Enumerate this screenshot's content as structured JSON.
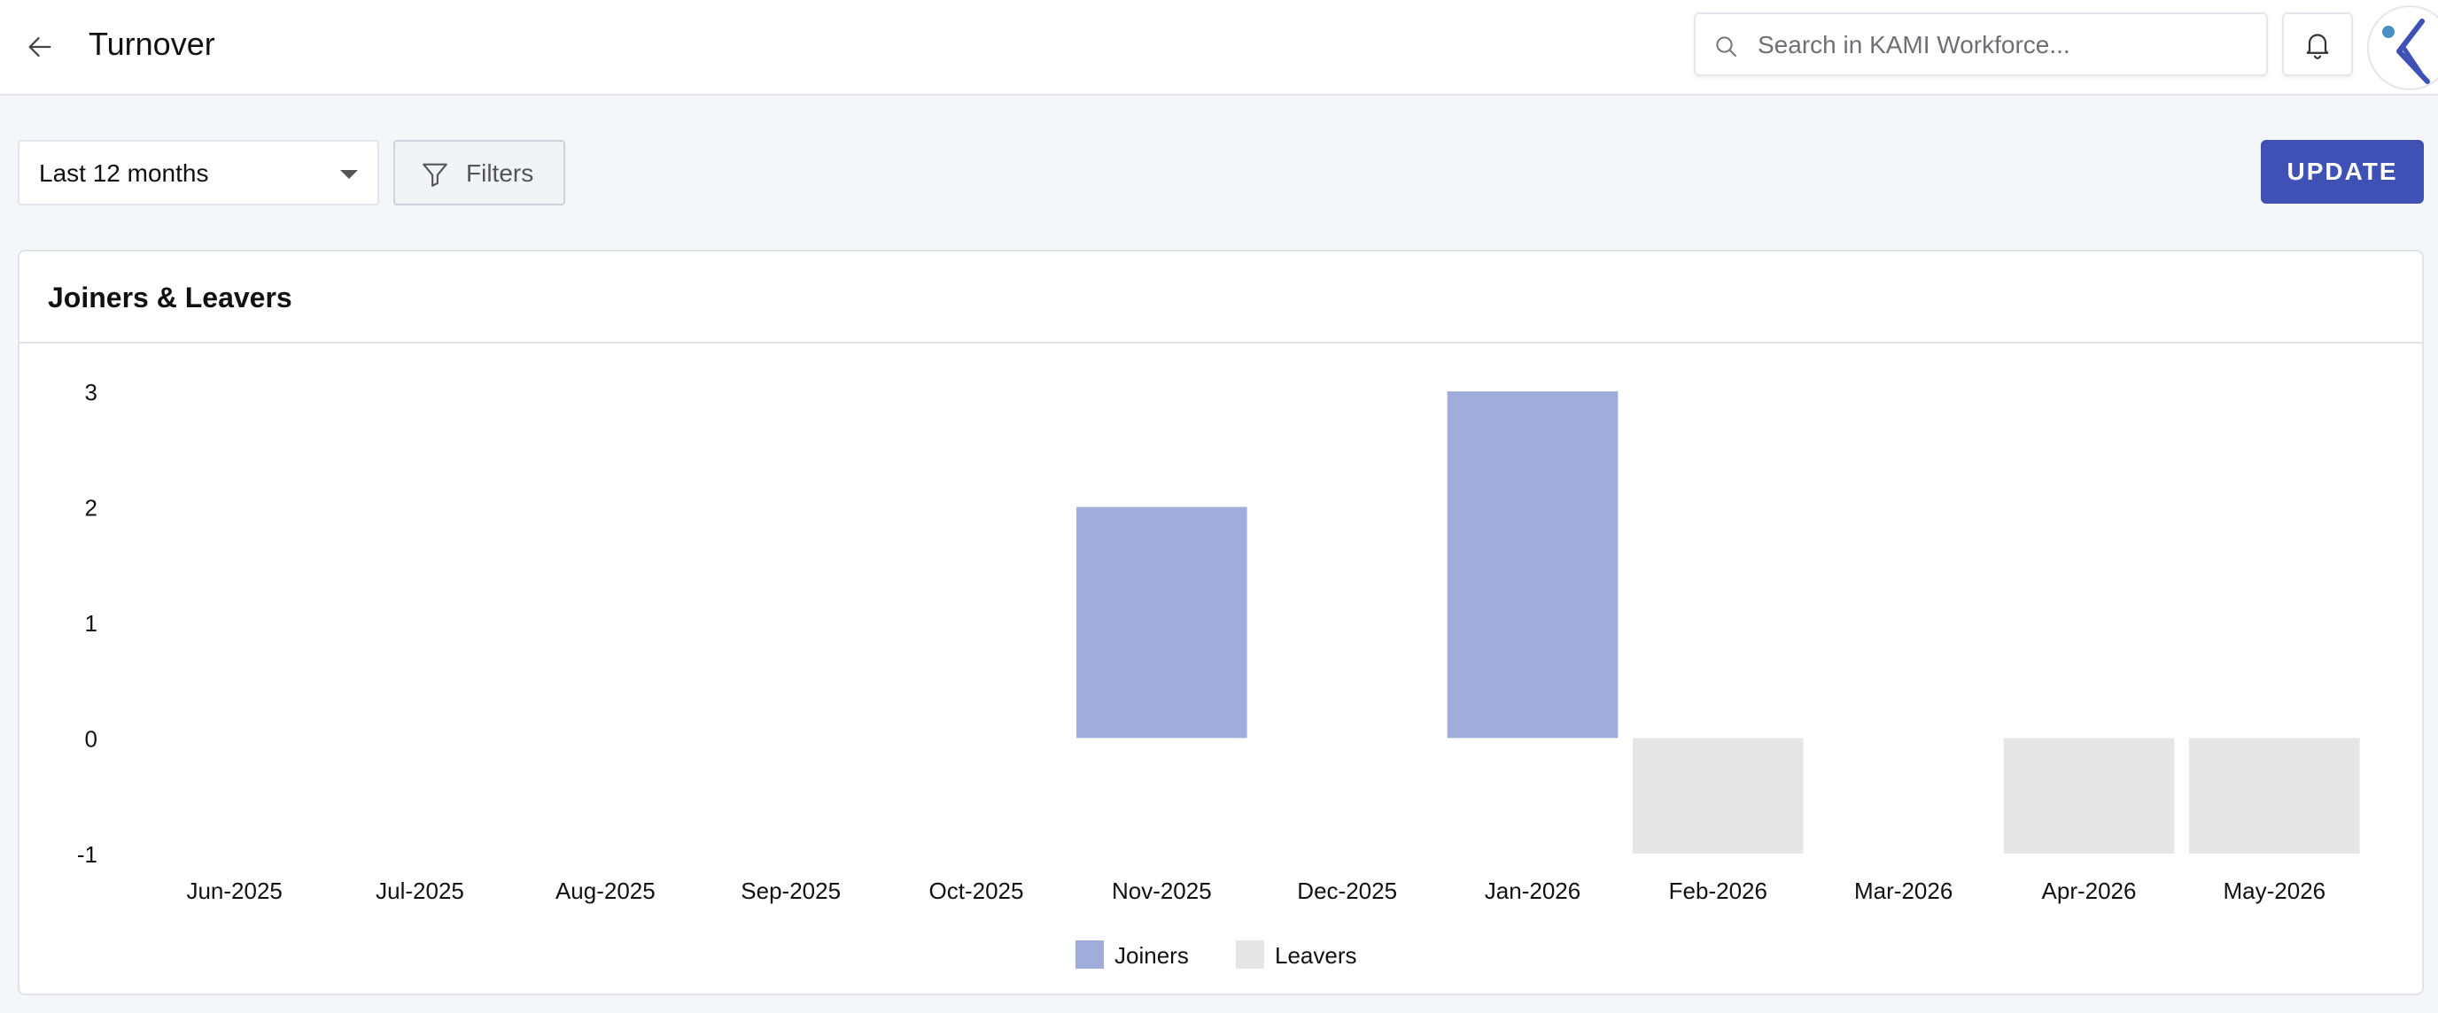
{
  "header": {
    "title": "Turnover",
    "search_placeholder": "Search in KAMI Workforce..."
  },
  "toolbar": {
    "period": "Last 12 months",
    "filters_label": "Filters",
    "update_label": "UPDATE"
  },
  "card": {
    "title": "Joiners & Leavers"
  },
  "colors": {
    "primary": "#3f51b5",
    "joiners": "#9facdc",
    "leavers": "#e6e6e6"
  },
  "chart_data": {
    "type": "bar",
    "title": "Joiners & Leavers",
    "categories": [
      "Jun-2025",
      "Jul-2025",
      "Aug-2025",
      "Sep-2025",
      "Oct-2025",
      "Nov-2025",
      "Dec-2025",
      "Jan-2026",
      "Feb-2026",
      "Mar-2026",
      "Apr-2026",
      "May-2026"
    ],
    "series": [
      {
        "name": "Joiners",
        "color": "#9facdc",
        "values": [
          0,
          0,
          0,
          0,
          0,
          2,
          0,
          3,
          0,
          0,
          0,
          0
        ]
      },
      {
        "name": "Leavers",
        "color": "#e6e6e6",
        "values": [
          0,
          0,
          0,
          0,
          0,
          0,
          0,
          0,
          -1,
          0,
          -1,
          -1
        ]
      }
    ],
    "ylim": [
      -1,
      3
    ],
    "yticks": [
      3,
      2,
      1,
      0,
      -1
    ],
    "stacked": true,
    "grid": false,
    "legend": "bottom-center"
  }
}
